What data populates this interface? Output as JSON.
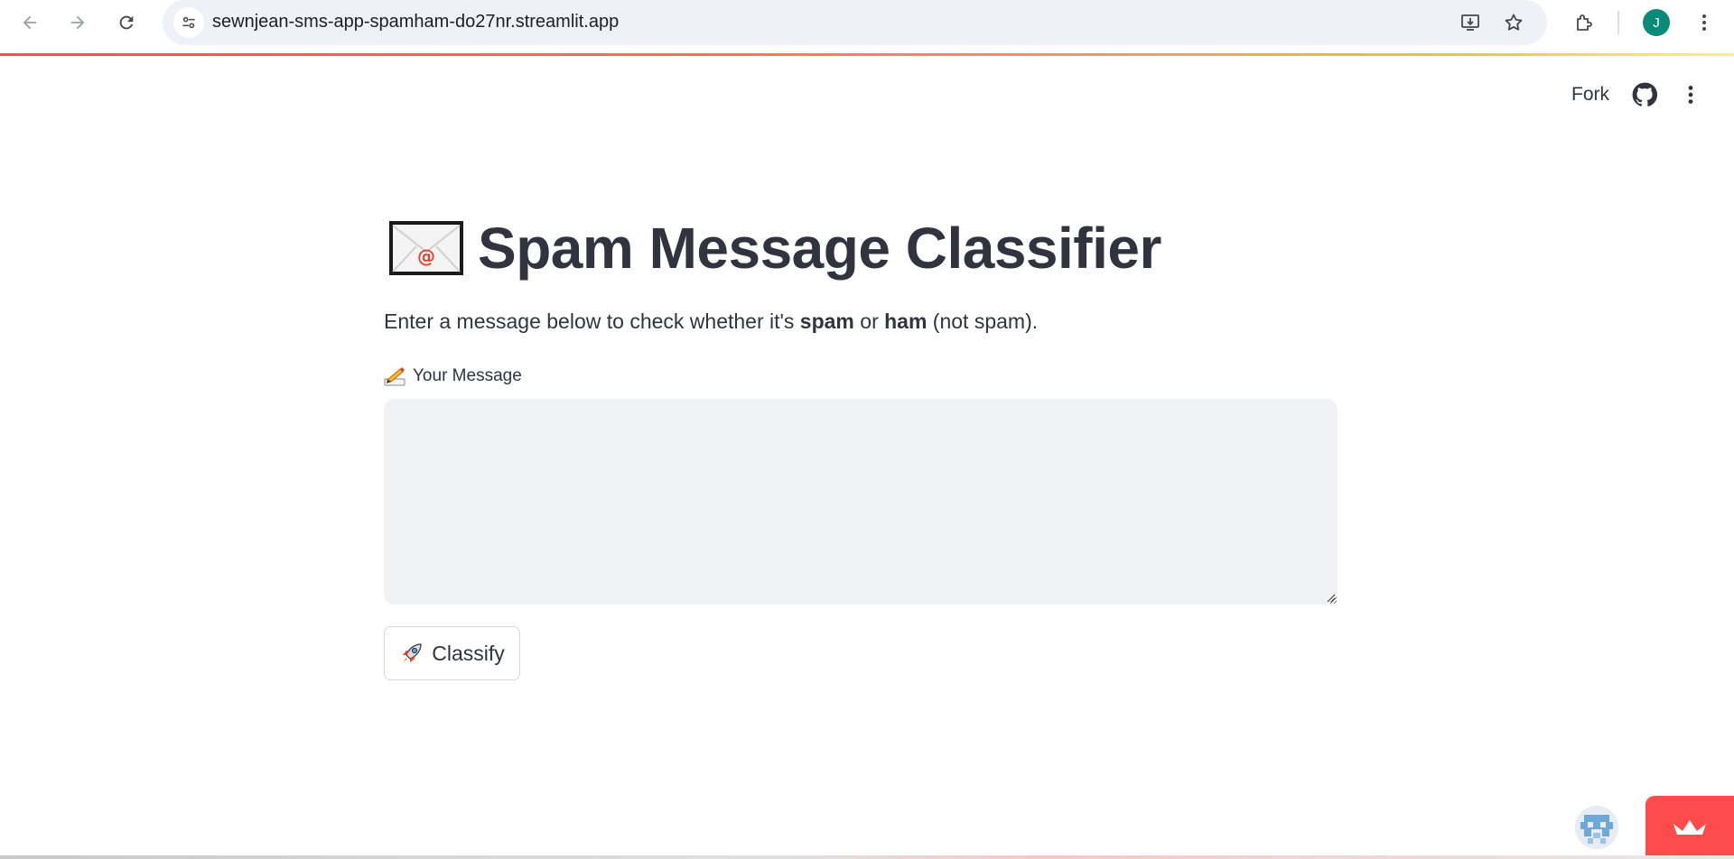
{
  "browser": {
    "url": "sewnjean-sms-app-spamham-do27nr.streamlit.app",
    "profile_initial": "J",
    "profile_color": "#0b8a7a"
  },
  "toolbar": {
    "fork_label": "Fork"
  },
  "page": {
    "title": "Spam Message Classifier",
    "description_prefix": "Enter a message below to check whether it's ",
    "description_spam": "spam",
    "description_or": " or ",
    "description_ham": "ham",
    "description_suffix": " (not spam).",
    "input_label": "Your Message",
    "input_value": "",
    "classify_label": "Classify"
  },
  "colors": {
    "accent": "#ff4b4b",
    "text": "#31333f",
    "input_bg": "#f0f2f6"
  },
  "icons": {
    "title": "envelope-icon",
    "input_label": "writing-hand-icon",
    "classify": "rocket-icon"
  }
}
